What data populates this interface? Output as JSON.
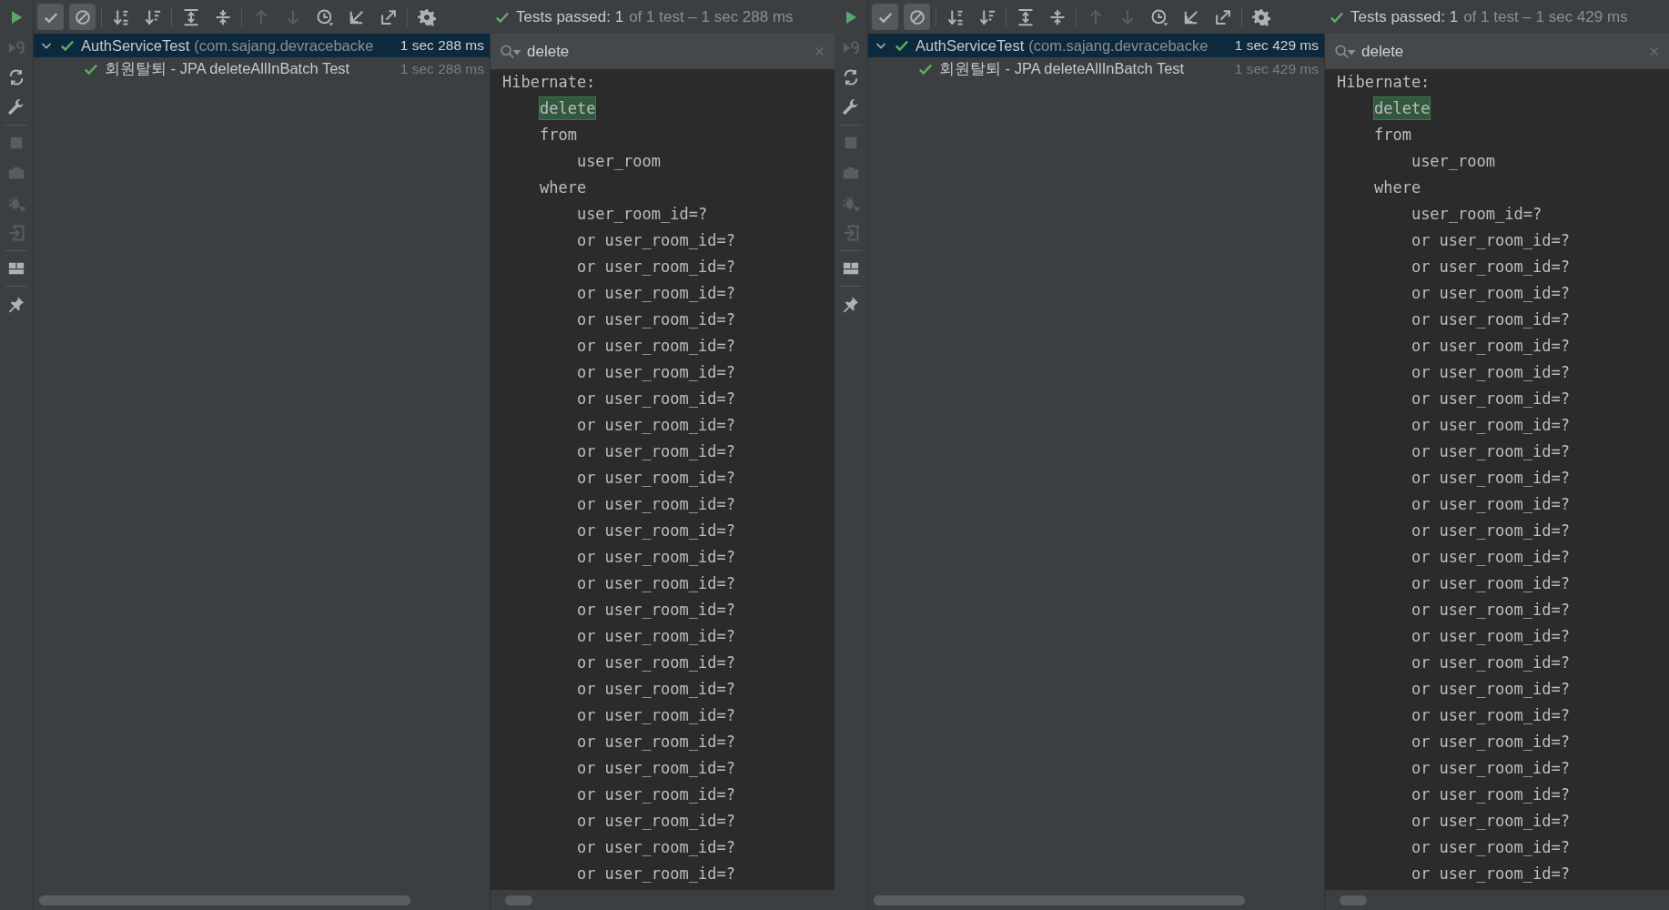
{
  "panels": [
    {
      "side_tools": [
        {
          "kind": "run",
          "disabled": false
        },
        {
          "kind": "rerun-failed",
          "disabled": true
        },
        {
          "kind": "auto-rerun",
          "disabled": false
        },
        {
          "kind": "wrench",
          "disabled": false
        },
        {
          "kind": "separator"
        },
        {
          "kind": "stop",
          "disabled": true
        },
        {
          "kind": "camera",
          "disabled": true
        },
        {
          "kind": "bug",
          "disabled": true
        },
        {
          "kind": "exit",
          "disabled": true
        },
        {
          "kind": "separator"
        },
        {
          "kind": "layout",
          "disabled": false
        },
        {
          "kind": "separator"
        },
        {
          "kind": "pin",
          "disabled": false
        }
      ],
      "toolbar": [
        {
          "kind": "check",
          "selected": true,
          "disabled": false
        },
        {
          "kind": "ignored",
          "selected": true,
          "disabled": false
        },
        {
          "kind": "separator"
        },
        {
          "kind": "sort-alpha",
          "selected": false,
          "disabled": false
        },
        {
          "kind": "sort-duration",
          "selected": false,
          "disabled": false
        },
        {
          "kind": "separator"
        },
        {
          "kind": "expand",
          "selected": false,
          "disabled": false
        },
        {
          "kind": "collapse",
          "selected": false,
          "disabled": false
        },
        {
          "kind": "separator"
        },
        {
          "kind": "up",
          "selected": false,
          "disabled": true
        },
        {
          "kind": "down",
          "selected": false,
          "disabled": true
        },
        {
          "kind": "history",
          "selected": false,
          "disabled": false
        },
        {
          "kind": "import",
          "selected": false,
          "disabled": false
        },
        {
          "kind": "export",
          "selected": false,
          "disabled": false
        },
        {
          "kind": "separator"
        },
        {
          "kind": "settings",
          "selected": false,
          "disabled": false
        }
      ],
      "status": {
        "passed": "Tests passed: 1",
        "detail": "of 1 test – 1 sec 288 ms"
      },
      "tree": [
        {
          "name": "AuthServiceTest",
          "package": "(com.sajang.devracebacke",
          "time": "1 sec 288 ms",
          "passed": true,
          "selected": true,
          "expanded": true,
          "children": [
            {
              "name": "회원탈퇴 - JPA deleteAllInBatch Test",
              "time": "1 sec 288 ms",
              "passed": true,
              "selected": false
            }
          ]
        }
      ],
      "search": {
        "value": "delete"
      },
      "console": [
        {
          "text": "Hibernate:",
          "match": false
        },
        {
          "text": "    delete",
          "match": true
        },
        {
          "text": "    from",
          "match": false
        },
        {
          "text": "        user_room",
          "match": false
        },
        {
          "text": "    where",
          "match": false
        },
        {
          "text": "        user_room_id=?",
          "match": false
        },
        {
          "text": "        or user_room_id=?",
          "match": false
        },
        {
          "text": "        or user_room_id=?",
          "match": false
        },
        {
          "text": "        or user_room_id=?",
          "match": false
        },
        {
          "text": "        or user_room_id=?",
          "match": false
        },
        {
          "text": "        or user_room_id=?",
          "match": false
        },
        {
          "text": "        or user_room_id=?",
          "match": false
        },
        {
          "text": "        or user_room_id=?",
          "match": false
        },
        {
          "text": "        or user_room_id=?",
          "match": false
        },
        {
          "text": "        or user_room_id=?",
          "match": false
        },
        {
          "text": "        or user_room_id=?",
          "match": false
        },
        {
          "text": "        or user_room_id=?",
          "match": false
        },
        {
          "text": "        or user_room_id=?",
          "match": false
        },
        {
          "text": "        or user_room_id=?",
          "match": false
        },
        {
          "text": "        or user_room_id=?",
          "match": false
        },
        {
          "text": "        or user_room_id=?",
          "match": false
        },
        {
          "text": "        or user_room_id=?",
          "match": false
        },
        {
          "text": "        or user_room_id=?",
          "match": false
        },
        {
          "text": "        or user_room_id=?",
          "match": false
        },
        {
          "text": "        or user_room_id=?",
          "match": false
        },
        {
          "text": "        or user_room_id=?",
          "match": false
        },
        {
          "text": "        or user_room_id=?",
          "match": false
        },
        {
          "text": "        or user_room_id=?",
          "match": false
        },
        {
          "text": "        or user_room_id=?",
          "match": false
        },
        {
          "text": "        or user_room_id=?",
          "match": false
        },
        {
          "text": "        or user_room_id=?",
          "match": false
        }
      ]
    },
    {
      "side_tools": [
        {
          "kind": "run",
          "disabled": false
        },
        {
          "kind": "rerun-failed",
          "disabled": true
        },
        {
          "kind": "auto-rerun",
          "disabled": false
        },
        {
          "kind": "wrench",
          "disabled": false
        },
        {
          "kind": "separator"
        },
        {
          "kind": "stop",
          "disabled": true
        },
        {
          "kind": "camera",
          "disabled": true
        },
        {
          "kind": "bug",
          "disabled": true
        },
        {
          "kind": "exit",
          "disabled": true
        },
        {
          "kind": "separator"
        },
        {
          "kind": "layout",
          "disabled": false
        },
        {
          "kind": "separator"
        },
        {
          "kind": "pin",
          "disabled": false
        }
      ],
      "toolbar": [
        {
          "kind": "check",
          "selected": true,
          "disabled": false
        },
        {
          "kind": "ignored",
          "selected": true,
          "disabled": false
        },
        {
          "kind": "separator"
        },
        {
          "kind": "sort-alpha",
          "selected": false,
          "disabled": false
        },
        {
          "kind": "sort-duration",
          "selected": false,
          "disabled": false
        },
        {
          "kind": "separator"
        },
        {
          "kind": "expand",
          "selected": false,
          "disabled": false
        },
        {
          "kind": "collapse",
          "selected": false,
          "disabled": false
        },
        {
          "kind": "separator"
        },
        {
          "kind": "up",
          "selected": false,
          "disabled": true
        },
        {
          "kind": "down",
          "selected": false,
          "disabled": true
        },
        {
          "kind": "history",
          "selected": false,
          "disabled": false
        },
        {
          "kind": "import",
          "selected": false,
          "disabled": false
        },
        {
          "kind": "export",
          "selected": false,
          "disabled": false
        },
        {
          "kind": "separator"
        },
        {
          "kind": "settings",
          "selected": false,
          "disabled": false
        }
      ],
      "status": {
        "passed": "Tests passed: 1",
        "detail": "of 1 test – 1 sec 429 ms"
      },
      "tree": [
        {
          "name": "AuthServiceTest",
          "package": "(com.sajang.devracebacke",
          "time": "1 sec 429 ms",
          "passed": true,
          "selected": true,
          "expanded": true,
          "children": [
            {
              "name": "회원탈퇴 - JPA deleteAllInBatch Test",
              "time": "1 sec 429 ms",
              "passed": true,
              "selected": false
            }
          ]
        }
      ],
      "search": {
        "value": "delete"
      },
      "console": [
        {
          "text": "Hibernate:",
          "match": false
        },
        {
          "text": "    delete",
          "match": true
        },
        {
          "text": "    from",
          "match": false
        },
        {
          "text": "        user_room",
          "match": false
        },
        {
          "text": "    where",
          "match": false
        },
        {
          "text": "        user_room_id=?",
          "match": false
        },
        {
          "text": "        or user_room_id=?",
          "match": false
        },
        {
          "text": "        or user_room_id=?",
          "match": false
        },
        {
          "text": "        or user_room_id=?",
          "match": false
        },
        {
          "text": "        or user_room_id=?",
          "match": false
        },
        {
          "text": "        or user_room_id=?",
          "match": false
        },
        {
          "text": "        or user_room_id=?",
          "match": false
        },
        {
          "text": "        or user_room_id=?",
          "match": false
        },
        {
          "text": "        or user_room_id=?",
          "match": false
        },
        {
          "text": "        or user_room_id=?",
          "match": false
        },
        {
          "text": "        or user_room_id=?",
          "match": false
        },
        {
          "text": "        or user_room_id=?",
          "match": false
        },
        {
          "text": "        or user_room_id=?",
          "match": false
        },
        {
          "text": "        or user_room_id=?",
          "match": false
        },
        {
          "text": "        or user_room_id=?",
          "match": false
        },
        {
          "text": "        or user_room_id=?",
          "match": false
        },
        {
          "text": "        or user_room_id=?",
          "match": false
        },
        {
          "text": "        or user_room_id=?",
          "match": false
        },
        {
          "text": "        or user_room_id=?",
          "match": false
        },
        {
          "text": "        or user_room_id=?",
          "match": false
        },
        {
          "text": "        or user_room_id=?",
          "match": false
        },
        {
          "text": "        or user_room_id=?",
          "match": false
        },
        {
          "text": "        or user_room_id=?",
          "match": false
        },
        {
          "text": "        or user_room_id=?",
          "match": false
        },
        {
          "text": "        or user_room_id=?",
          "match": false
        },
        {
          "text": "        or user_room_id=?",
          "match": false
        }
      ]
    }
  ]
}
